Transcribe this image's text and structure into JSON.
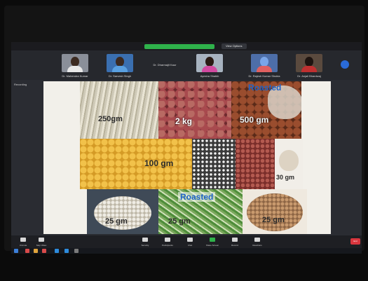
{
  "meeting": {
    "participants": [
      {
        "name": "Dr. Mahendra Kumar"
      },
      {
        "name": "Dr. Sarvesh Singh"
      },
      {
        "name": "Dr. Dharmajit Kaur"
      },
      {
        "name": "Ayesha Shaikh"
      },
      {
        "name": "Dr. Rajesh Kumar Shukla"
      },
      {
        "name": "Dr. Anjali Bhardwaj"
      }
    ],
    "view_button": "View Options",
    "recording_label": "Recording"
  },
  "slide": {
    "labels": {
      "c1": "250gm",
      "c2": "2 kg",
      "c3": "500 gm",
      "c3_tag": "Roasted",
      "c4": "100 gm",
      "c7": "30 gm",
      "c8": "25 gm",
      "c9": "25 gm",
      "c9_tag": "Roasted",
      "c10": "25 gm"
    }
  },
  "toolbar": {
    "items": [
      {
        "label": "Unmute",
        "icon": "microphone-icon"
      },
      {
        "label": "Stop Video",
        "icon": "video-camera-icon"
      },
      {
        "label": "Security",
        "icon": "shield-icon"
      },
      {
        "label": "Participants",
        "icon": "people-icon"
      },
      {
        "label": "Chat",
        "icon": "chat-icon"
      },
      {
        "label": "Share Screen",
        "icon": "share-screen-icon"
      },
      {
        "label": "Record",
        "icon": "record-icon"
      },
      {
        "label": "Reactions",
        "icon": "smiley-icon"
      }
    ],
    "end_label": "End"
  },
  "colors": {
    "accent_green": "#2fb24b",
    "accent_blue": "#2a6bd8",
    "end_red": "#d9363e"
  }
}
